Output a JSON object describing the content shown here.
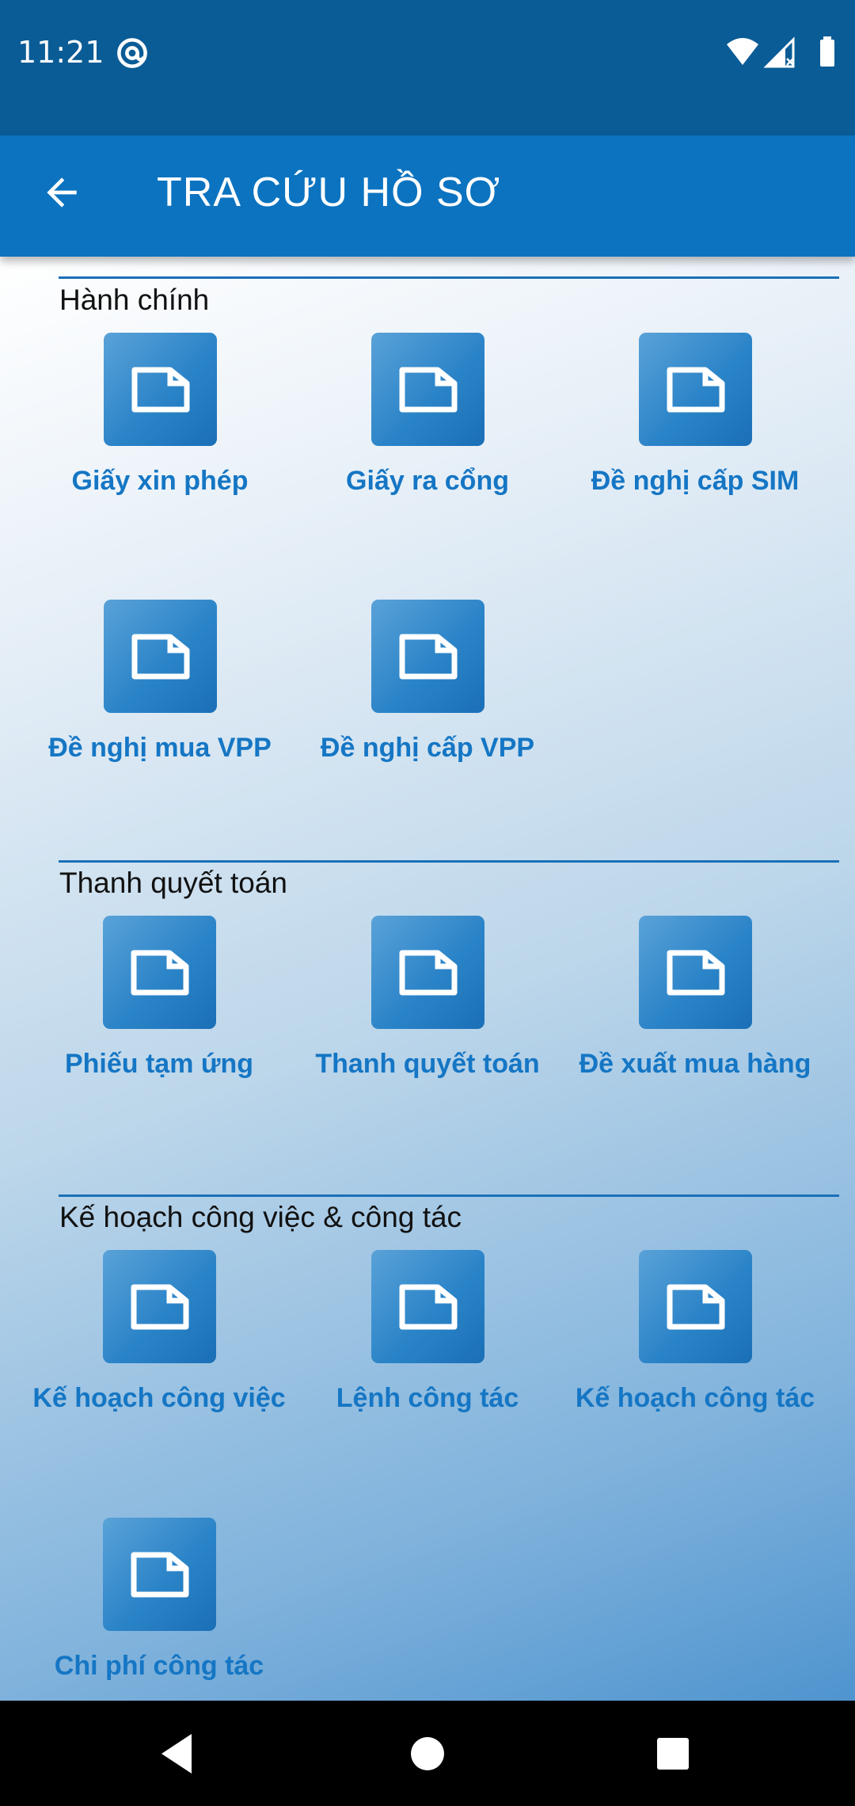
{
  "status_bar": {
    "time": "11:21",
    "icons": [
      "at-sign-icon",
      "wifi-icon",
      "cell-signal-icon",
      "battery-icon"
    ]
  },
  "app_bar": {
    "title": "TRA CỨU HỒ SƠ",
    "back_icon": "arrow-left-icon"
  },
  "colors": {
    "status_bar": "#0a5c96",
    "app_bar": "#0b73c0",
    "accent": "#1576c4",
    "tile": "#2b84c8"
  },
  "sections": [
    {
      "title": "Hành chính",
      "items": [
        {
          "label": "Giấy xin phép"
        },
        {
          "label": "Giấy ra cổng"
        },
        {
          "label": "Đề nghị cấp SIM"
        },
        {
          "label": "Đề nghị mua VPP"
        },
        {
          "label": "Đề nghị cấp VPP"
        }
      ]
    },
    {
      "title": "Thanh quyết toán",
      "items": [
        {
          "label": "Phiếu tạm ứng"
        },
        {
          "label": "Thanh quyết toán"
        },
        {
          "label": "Đề xuất mua hàng"
        }
      ]
    },
    {
      "title": "Kế hoạch công việc & công tác",
      "items": [
        {
          "label": "Kế hoạch công việc"
        },
        {
          "label": "Lệnh công tác"
        },
        {
          "label": "Kế hoạch công tác"
        },
        {
          "label": "Chi phí công tác"
        }
      ]
    }
  ],
  "nav_bar": {
    "icons": [
      "back-triangle-icon",
      "home-circle-icon",
      "recents-square-icon"
    ]
  }
}
